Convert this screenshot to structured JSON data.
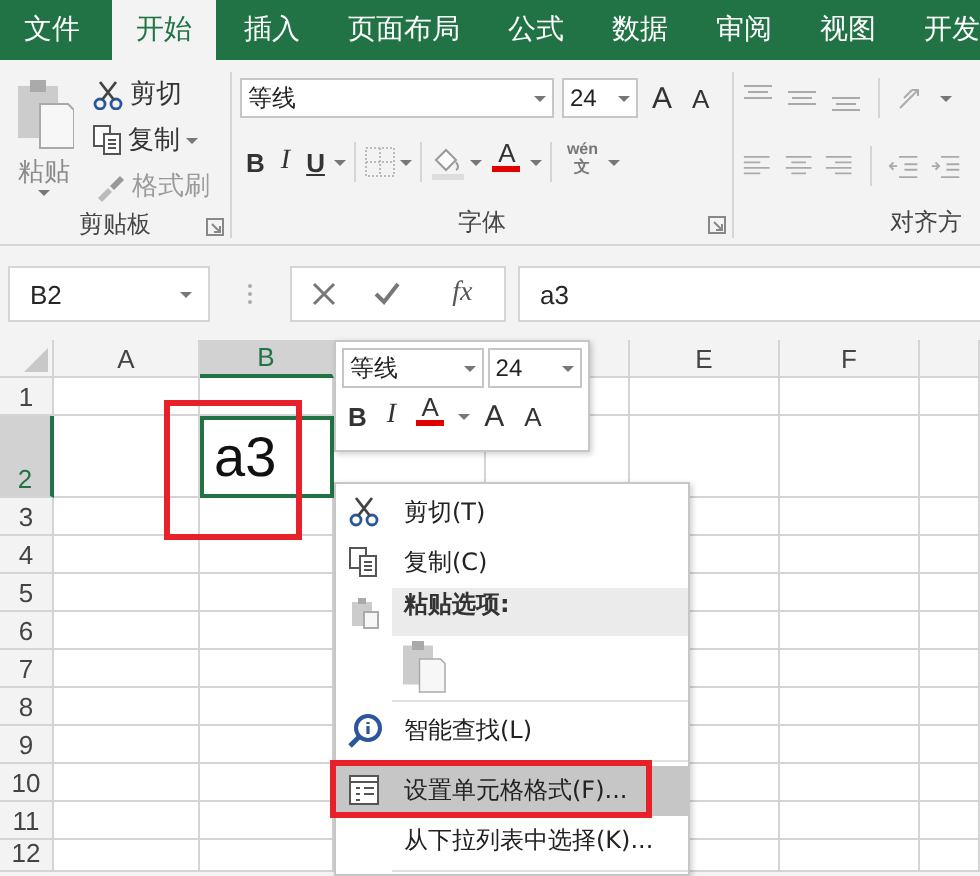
{
  "ribbon_tabs": [
    {
      "label": "文件",
      "selected": false
    },
    {
      "label": "开始",
      "selected": true
    },
    {
      "label": "插入",
      "selected": false
    },
    {
      "label": "页面布局",
      "selected": false
    },
    {
      "label": "公式",
      "selected": false
    },
    {
      "label": "数据",
      "selected": false
    },
    {
      "label": "审阅",
      "selected": false
    },
    {
      "label": "视图",
      "selected": false
    },
    {
      "label": "开发",
      "selected": false
    }
  ],
  "clipboard_group": {
    "title": "剪贴板",
    "paste": "粘贴",
    "cut": "剪切",
    "copy": "复制",
    "format_painter": "格式刷"
  },
  "font_group": {
    "title": "字体",
    "font": "等线",
    "size": "24",
    "bold": "B",
    "italic": "I",
    "underline": "U",
    "font_color": "A",
    "grow": "A",
    "shrink": "A",
    "phonetic": "wén",
    "phonetic_char": "文"
  },
  "alignment_group": {
    "title": "对齐方"
  },
  "name_box": "B2",
  "function_button": "fx",
  "formula": "a3",
  "columns": [
    {
      "label": "A",
      "selected": false
    },
    {
      "label": "B",
      "selected": true
    },
    {},
    {
      "selected": false
    },
    {
      "label": "E",
      "selected": false
    },
    {
      "label": "F",
      "selected": false
    },
    {
      "selected": false
    }
  ],
  "rows": [
    {
      "label": "1",
      "selected": false
    },
    {
      "label": "2",
      "selected": true,
      "cells": [
        {},
        {
          "value": "a3",
          "active": true,
          "annotated": true
        }
      ]
    },
    {
      "label": "3",
      "selected": false
    },
    {
      "label": "4",
      "selected": false
    },
    {
      "label": "5",
      "selected": false
    },
    {
      "label": "6",
      "selected": false
    },
    {
      "label": "7",
      "selected": false
    },
    {
      "label": "8",
      "selected": false
    },
    {
      "label": "9",
      "selected": false
    },
    {
      "label": "10",
      "selected": false
    },
    {
      "label": "11",
      "selected": false
    },
    {
      "label": "12",
      "selected": false
    }
  ],
  "mini_toolbar": {
    "font": "等线",
    "size": "24",
    "bold": "B",
    "italic": "I",
    "font_color": "A",
    "grow": "A",
    "shrink": "A"
  },
  "context_menu": {
    "items": [
      {
        "kind": "command",
        "label": "剪切(T)",
        "selected": false
      },
      {
        "kind": "command",
        "label": "复制(C)",
        "selected": false
      },
      {
        "kind": "heading",
        "label": "粘贴选项:"
      },
      {
        "kind": "paste-options"
      },
      {
        "kind": "separator"
      },
      {
        "kind": "command",
        "label": "智能查找(L)",
        "selected": false
      },
      {
        "kind": "separator"
      },
      {
        "kind": "command",
        "label": "设置单元格格式(F)...",
        "selected": true,
        "annotated": true
      },
      {
        "kind": "command",
        "label": "从下拉列表中选择(K)...",
        "selected": false
      },
      {
        "kind": "separator"
      }
    ]
  }
}
